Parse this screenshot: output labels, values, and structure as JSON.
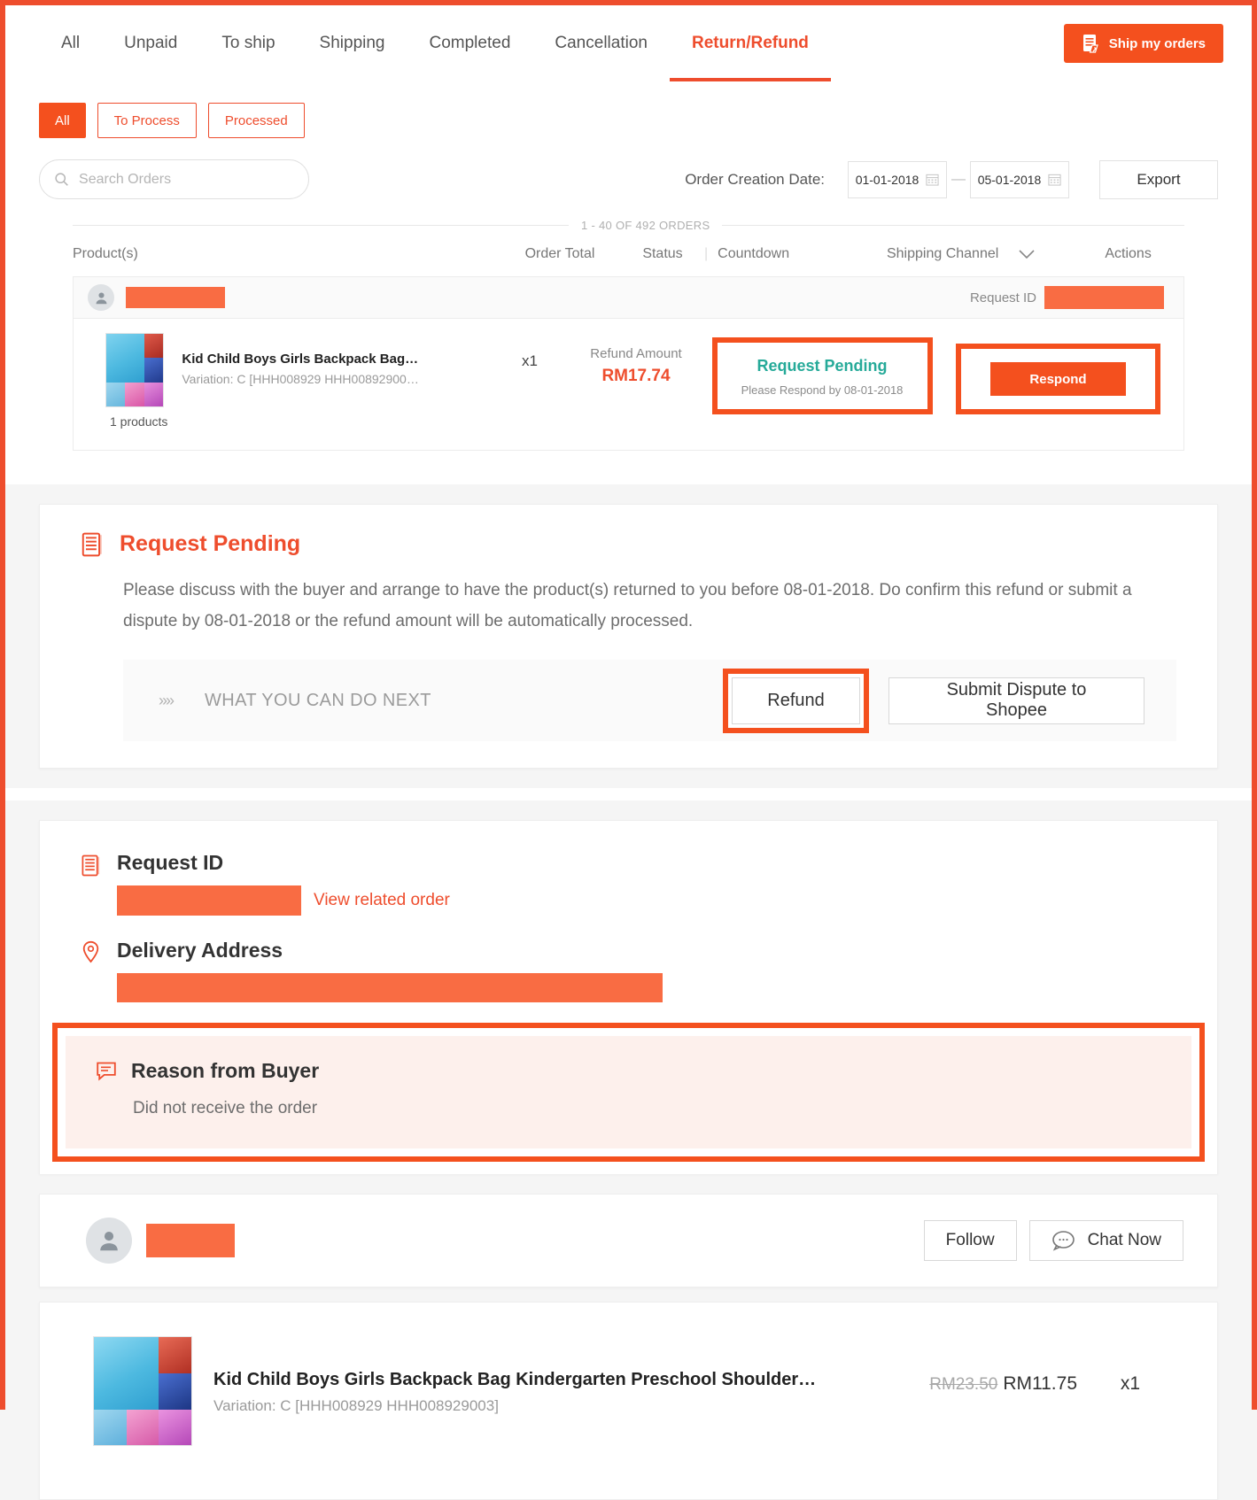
{
  "tabs": [
    {
      "label": "All",
      "active": false
    },
    {
      "label": "Unpaid",
      "active": false
    },
    {
      "label": "To ship",
      "active": false
    },
    {
      "label": "Shipping",
      "active": false
    },
    {
      "label": "Completed",
      "active": false
    },
    {
      "label": "Cancellation",
      "active": false
    },
    {
      "label": "Return/Refund",
      "active": true
    }
  ],
  "header": {
    "ship_button": "Ship my orders"
  },
  "filters": {
    "pills": [
      {
        "label": "All",
        "selected": true
      },
      {
        "label": "To Process",
        "selected": false
      },
      {
        "label": "Processed",
        "selected": false
      }
    ],
    "search_placeholder": "Search Orders",
    "search_value": "",
    "date_label": "Order Creation Date:",
    "date_from": "01-01-2018",
    "date_to": "05-01-2018",
    "date_separator": "—",
    "export_label": "Export"
  },
  "list": {
    "count_text": "1 - 40 OF 492 ORDERS",
    "columns": {
      "product": "Product(s)",
      "order_total": "Order Total",
      "status": "Status",
      "countdown": "Countdown",
      "shipping_channel": "Shipping Channel",
      "actions": "Actions"
    },
    "order": {
      "buyer_name_redacted": "",
      "request_id_label": "Request ID",
      "request_id_redacted": "",
      "product_name": "Kid Child Boys Girls Backpack Bag…",
      "product_variation": "Variation: C [HHH008929 HHH00892900…",
      "products_count": "1 products",
      "quantity": "x1",
      "refund_label": "Refund Amount",
      "refund_amount": "RM17.74",
      "status_main": "Request Pending",
      "status_sub": "Please Respond by 08-01-2018",
      "respond_label": "Respond"
    }
  },
  "request_pending": {
    "title": "Request Pending",
    "body": "Please discuss with the buyer and arrange to have the product(s) returned to you before 08-01-2018. Do confirm this refund or submit a dispute by 08-01-2018 or the refund amount will be automatically processed.",
    "next_label": "WHAT YOU CAN DO NEXT",
    "refund_button": "Refund",
    "dispute_button": "Submit Dispute to Shopee"
  },
  "details": {
    "request_id_title": "Request ID",
    "request_id_redacted": "",
    "view_related_order": "View related order",
    "delivery_address_title": "Delivery Address",
    "delivery_address_redacted": "",
    "reason_title": "Reason from Buyer",
    "reason_text": "Did not receive the order"
  },
  "buyer": {
    "name_redacted": "",
    "follow_label": "Follow",
    "chat_label": "Chat Now"
  },
  "product": {
    "name": "Kid Child Boys Girls Backpack Bag Kindergarten Preschool Shoulder…",
    "variation": "Variation: C [HHH008929 HHH008929003]",
    "original_price": "RM23.50",
    "price": "RM11.75",
    "quantity": "x1"
  },
  "colors": {
    "brand_orange": "#ee4d2d",
    "button_orange": "#f4501e",
    "status_teal": "#26aa99",
    "redaction": "#f96c43",
    "reason_bg": "#fdf0ec"
  }
}
